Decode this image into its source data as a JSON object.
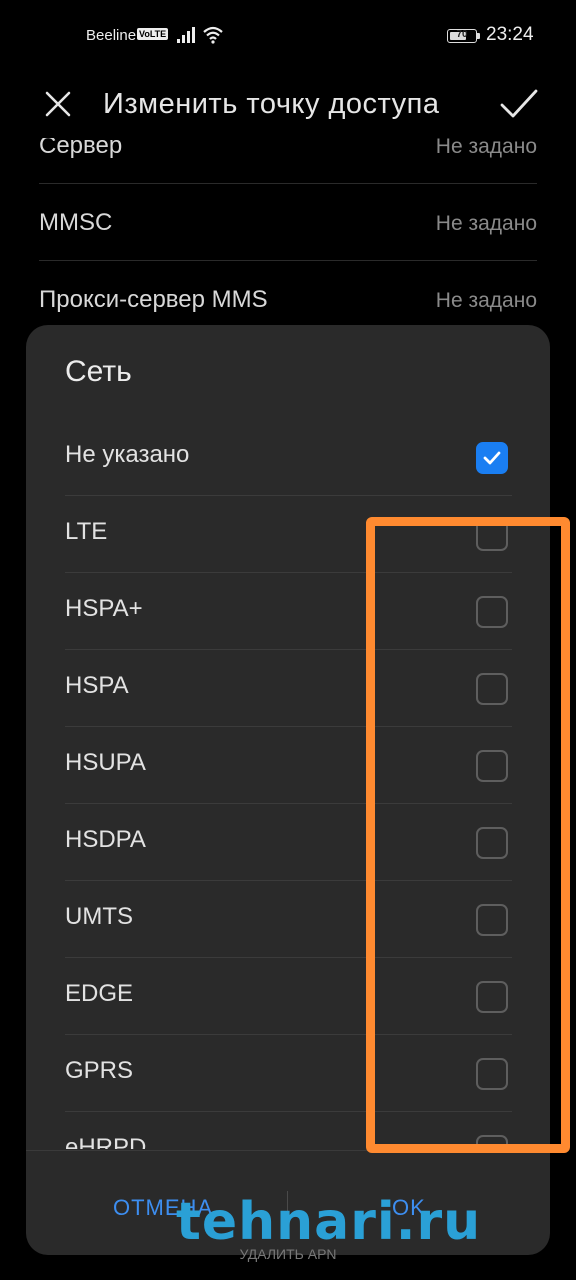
{
  "status_bar": {
    "carrier": "Beeline",
    "volte": "VoLTE",
    "battery": "70",
    "time": "23:24"
  },
  "toolbar": {
    "title": "Изменить точку доступа"
  },
  "settings": [
    {
      "label": "Сервер",
      "value": "Не задано"
    },
    {
      "label": "MMSC",
      "value": "Не задано"
    },
    {
      "label": "Прокси-сервер MMS",
      "value": "Не задано"
    }
  ],
  "dialog": {
    "title": "Сеть",
    "options": [
      {
        "label": "Не указано",
        "checked": true
      },
      {
        "label": "LTE",
        "checked": false
      },
      {
        "label": "HSPA+",
        "checked": false
      },
      {
        "label": "HSPA",
        "checked": false
      },
      {
        "label": "HSUPA",
        "checked": false
      },
      {
        "label": "HSDPA",
        "checked": false
      },
      {
        "label": "UMTS",
        "checked": false
      },
      {
        "label": "EDGE",
        "checked": false
      },
      {
        "label": "GPRS",
        "checked": false
      },
      {
        "label": "eHRPD",
        "checked": false
      }
    ],
    "cancel": "ОТМЕНА",
    "ok": "OK"
  },
  "bottom_action": "УДАЛИТЬ APN",
  "watermark": "tehnari.ru",
  "colors": {
    "accent": "#1a7ef2",
    "highlight": "#ff8a30",
    "dialog_bg": "#2a2a2a"
  }
}
